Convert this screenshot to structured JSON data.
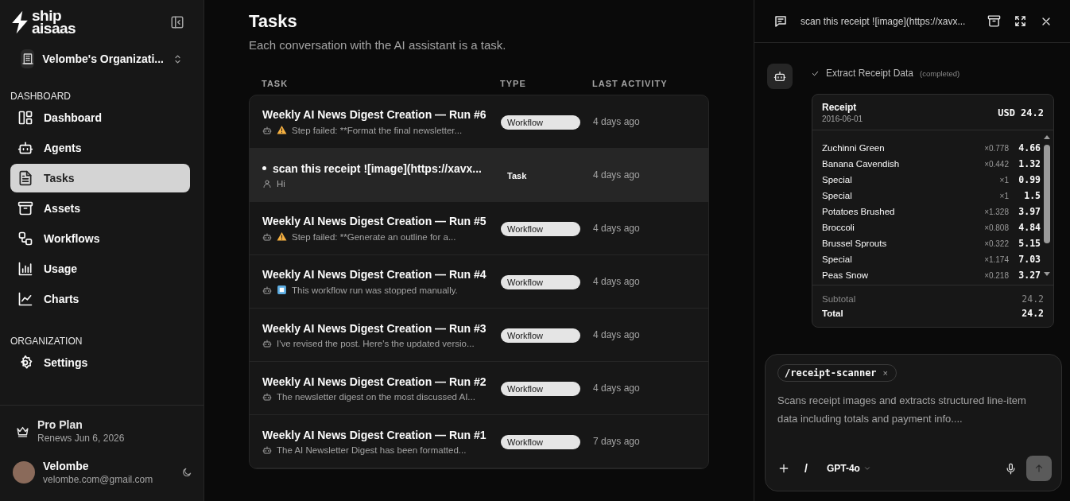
{
  "sidebar": {
    "logo": {
      "line1": "ship",
      "line2": "aisaas"
    },
    "organization": "Velombe's Organizati...",
    "sections": [
      {
        "label": "DASHBOARD",
        "items": [
          {
            "label": "Dashboard",
            "selected": false
          },
          {
            "label": "Agents",
            "selected": false
          },
          {
            "label": "Tasks",
            "selected": true
          },
          {
            "label": "Assets",
            "selected": false
          },
          {
            "label": "Workflows",
            "selected": false
          },
          {
            "label": "Usage",
            "selected": false
          },
          {
            "label": "Charts",
            "selected": false
          }
        ]
      },
      {
        "label": "ORGANIZATION",
        "items": [
          {
            "label": "Settings",
            "selected": false
          }
        ]
      }
    ],
    "plan": {
      "name": "Pro Plan",
      "renews": "Renews Jun 6, 2026"
    },
    "user": {
      "name": "Velombe",
      "email": "velombe.com@gmail.com"
    }
  },
  "main": {
    "title": "Tasks",
    "subtitle": "Each conversation with the AI assistant is a task.",
    "table": {
      "columns": [
        "TASK",
        "TYPE",
        "LAST ACTIVITY"
      ],
      "rows": [
        {
          "title": "Weekly AI News Digest Creation — Run #6",
          "author": {
            "kind": "agent"
          },
          "status": {
            "kind": "warning"
          },
          "preview": "Step failed: **Format the final newsletter...",
          "kind": "workflow",
          "type": "Workflow",
          "activity": "4 days ago",
          "selected": false,
          "unread": false
        },
        {
          "title": "scan this receipt ![image](https://xavx...",
          "author": {
            "kind": "user"
          },
          "preview": "Hi",
          "kind": "task",
          "type": "Task",
          "activity": "4 days ago",
          "selected": true,
          "unread": true
        },
        {
          "title": "Weekly AI News Digest Creation — Run #5",
          "author": {
            "kind": "agent"
          },
          "status": {
            "kind": "warning"
          },
          "preview": "Step failed: **Generate an outline for a...",
          "kind": "workflow",
          "type": "Workflow",
          "activity": "4 days ago",
          "selected": false,
          "unread": false
        },
        {
          "title": "Weekly AI News Digest Creation — Run #4",
          "author": {
            "kind": "agent"
          },
          "status": {
            "kind": "stopped"
          },
          "preview": "This workflow run was stopped manually.",
          "kind": "workflow",
          "type": "Workflow",
          "activity": "4 days ago",
          "selected": false,
          "unread": false
        },
        {
          "title": "Weekly AI News Digest Creation — Run #3",
          "author": {
            "kind": "agent"
          },
          "preview": "I've revised the post. Here's the updated versio...",
          "kind": "workflow",
          "type": "Workflow",
          "activity": "4 days ago",
          "selected": false,
          "unread": false
        },
        {
          "title": "Weekly AI News Digest Creation — Run #2",
          "author": {
            "kind": "agent"
          },
          "preview": "The newsletter digest on the most discussed AI...",
          "kind": "workflow",
          "type": "Workflow",
          "activity": "4 days ago",
          "selected": false,
          "unread": false
        },
        {
          "title": "Weekly AI News Digest Creation — Run #1",
          "author": {
            "kind": "agent"
          },
          "preview": "The AI Newsletter Digest has been formatted...",
          "kind": "workflow",
          "type": "Workflow",
          "activity": "7 days ago",
          "selected": false,
          "unread": false
        }
      ]
    }
  },
  "panel": {
    "title": "scan this receipt ![image](https://xavx...",
    "step": {
      "label": "Extract Receipt Data",
      "status": "(completed)"
    },
    "receipt": {
      "title": "Receipt",
      "date": "2016-06-01",
      "amount": "USD 24.2",
      "items": [
        {
          "name": "Zuchinni Green",
          "qty": "×0.778",
          "price": "4.66"
        },
        {
          "name": "Banana Cavendish",
          "qty": "×0.442",
          "price": "1.32"
        },
        {
          "name": "Special",
          "qty": "×1",
          "price": "0.99"
        },
        {
          "name": "Special",
          "qty": "×1",
          "price": "1.5"
        },
        {
          "name": "Potatoes Brushed",
          "qty": "×1.328",
          "price": "3.97"
        },
        {
          "name": "Broccoli",
          "qty": "×0.808",
          "price": "4.84"
        },
        {
          "name": "Brussel Sprouts",
          "qty": "×0.322",
          "price": "5.15"
        },
        {
          "name": "Special",
          "qty": "×1.174",
          "price": "7.03"
        },
        {
          "name": "Peas Snow",
          "qty": "×0.218",
          "price": "3.27"
        }
      ],
      "subtotal_label": "Subtotal",
      "subtotal": "24.2",
      "total_label": "Total",
      "total": "24.2"
    },
    "composer": {
      "chip": "/receipt-scanner",
      "chip_close": "×",
      "text": "Scans receipt images and extracts structured line-item data including totals and payment info....",
      "slash": "/",
      "model": "GPT-4o"
    }
  }
}
